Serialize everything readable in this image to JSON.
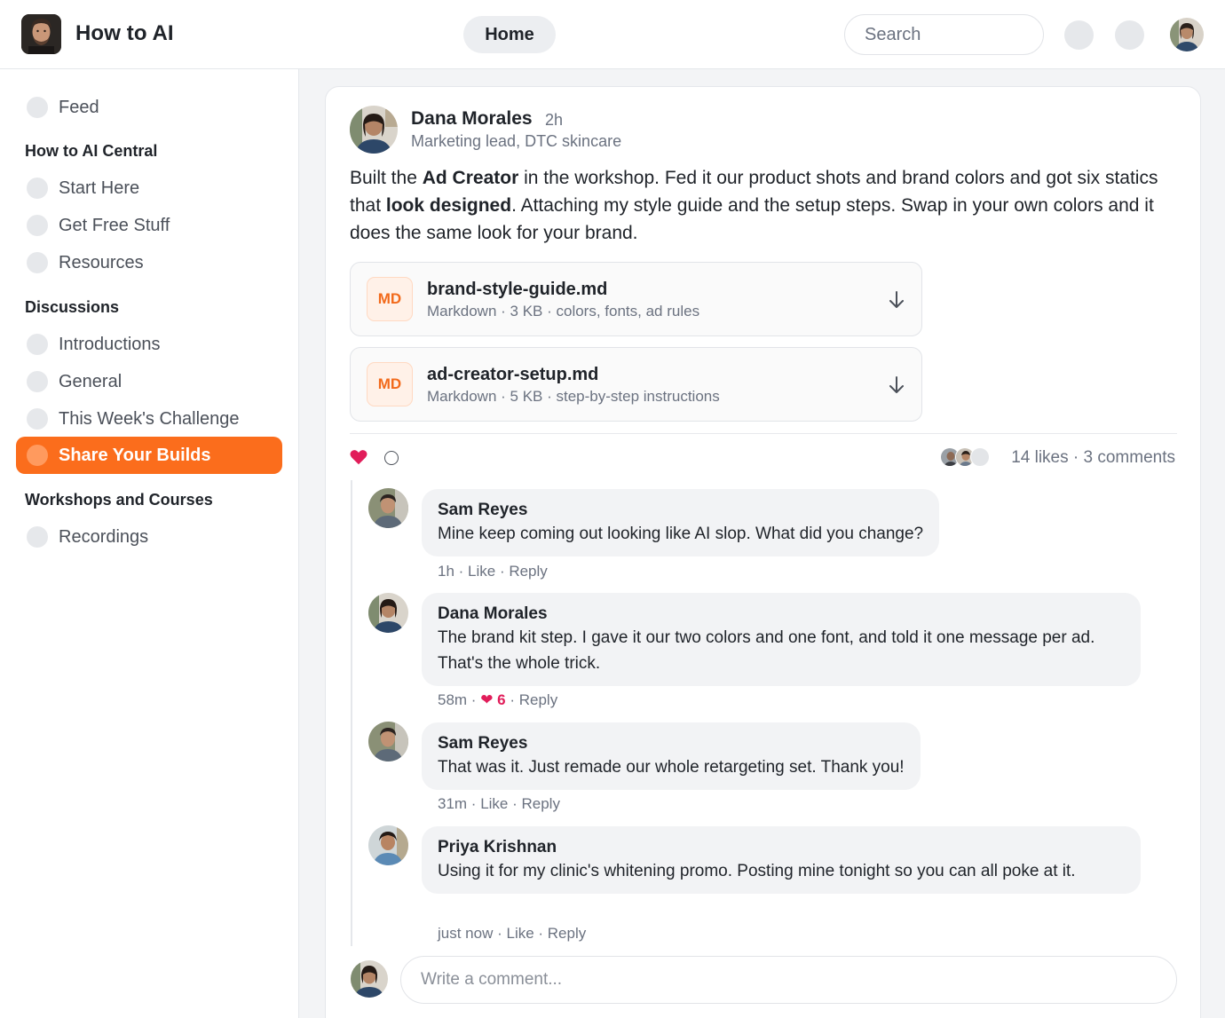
{
  "app": {
    "title": "How to AI"
  },
  "header": {
    "home_label": "Home",
    "search_placeholder": "Search"
  },
  "sidebar": {
    "feed": "Feed",
    "sections": [
      {
        "heading": "How to AI Central",
        "items": [
          "Start Here",
          "Get Free Stuff",
          "Resources"
        ]
      },
      {
        "heading": "Discussions",
        "items": [
          "Introductions",
          "General",
          "This Week's Challenge",
          "Share Your Builds"
        ]
      },
      {
        "heading": "Workshops and Courses",
        "items": [
          "Recordings"
        ]
      }
    ],
    "active_item": "Share Your Builds"
  },
  "post": {
    "author": "Dana Morales",
    "time": "2h",
    "role": "Marketing lead, DTC skincare",
    "body": {
      "p1": "Built the ",
      "b1": "Ad Creator",
      "p2": " in the workshop. Fed it our product shots and brand colors and got six statics that ",
      "b2": "look designed",
      "p3": ". Attaching my style guide and the setup steps. Swap in your own colors and it does the same look for your brand."
    },
    "attachments": [
      {
        "badge": "MD",
        "name": "brand-style-guide.md",
        "meta": "Markdown · 3 KB · colors, fonts, ad rules"
      },
      {
        "badge": "MD",
        "name": "ad-creator-setup.md",
        "meta": "Markdown · 5 KB · step-by-step instructions"
      }
    ],
    "stats": "14 likes · 3 comments",
    "comments": [
      {
        "name": "Sam Reyes",
        "text": "Mine keep coming out looking like AI slop. What did you change?",
        "time": "1h",
        "like": "Like",
        "reply": "Reply"
      },
      {
        "name": "Dana Morales",
        "text": "The brand kit step. I gave it our two colors and one font, and told it one message per ad. That's the whole trick.",
        "time": "58m",
        "heart_count": "6",
        "reply": "Reply"
      },
      {
        "name": "Sam Reyes",
        "text": "That was it. Just remade our whole retargeting set. Thank you!",
        "time": "31m",
        "like": "Like",
        "reply": "Reply"
      },
      {
        "name": "Priya Krishnan",
        "text": "Using it for my clinic's whitening promo. Posting mine tonight so you can all poke at it.",
        "time": "just now",
        "like": "Like",
        "reply": "Reply"
      }
    ],
    "comment_placeholder": "Write a comment..."
  },
  "colors": {
    "accent": "#fb6d1c",
    "heart": "#e11d5a",
    "badge_text": "#f26a1b"
  },
  "icons": {
    "download": "download-arrow-icon",
    "like": "heart-icon",
    "comment": "comment-circle-icon"
  }
}
